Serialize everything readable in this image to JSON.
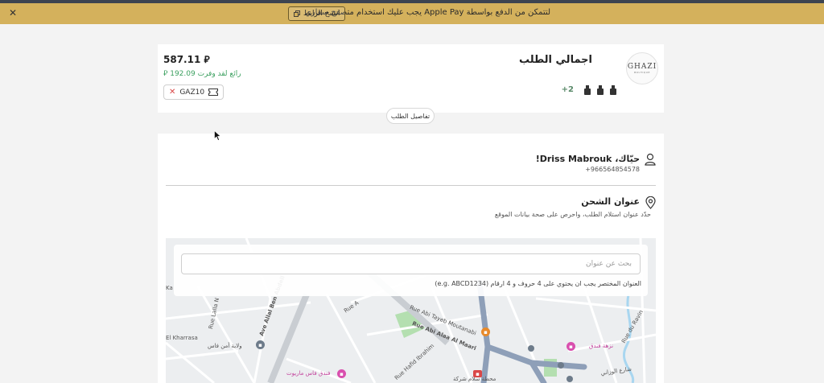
{
  "banner": {
    "message": "لتتمكن من الدفع بواسطة Apple Pay يجب عليك استخدام متصفح سفاري",
    "copy_label": "انسخ الرابط",
    "copy_icon": "copy-icon",
    "close_icon": "close-icon",
    "bg_color": "#d4b15c"
  },
  "summary": {
    "logo_text": "GHAZI",
    "logo_sub": "BOUTIQUE",
    "title": "اجمالي الطلب",
    "more_count": "+2",
    "price": "587.11 ⃁",
    "saving": "رائع لقد وفرت 192.09 ⃁",
    "coupon_code": "GAZ10",
    "details_label": "تفاصيل الطلب",
    "saving_color": "#3ca060"
  },
  "customer": {
    "greeting": "حيّاك، Driss Mabrouk!",
    "phone": "+966564854578",
    "user_icon": "user-icon"
  },
  "shipping": {
    "title": "عنوان الشحن",
    "subtitle": "حدّد عنوان استلام الطلب، واحرص على صحة بيانات الموقع",
    "pin_icon": "location-pin-icon"
  },
  "search": {
    "placeholder": "بحث عن عنوان",
    "hint": "العنوان المختصر يجب ان يحتوي على 4 حروف و 4 ارقام (e.g. ABCD1234)"
  },
  "map": {
    "labels": [
      "Ave Allal Ben Abdell",
      "Rue Abi Tayeb Moutanabi",
      "Rue Abi Alaa Al Maari",
      "Rue Hafid Ibrahim",
      "Rue Lalla N",
      "Rue du Ravin",
      "El Kharrasa",
      "ولاية أمن فاس",
      "نزهة فندق",
      "فندق فاس ماريوت",
      "محطة سلام شركة",
      "Rue A",
      "Ka",
      "شارع الوزاني"
    ]
  }
}
